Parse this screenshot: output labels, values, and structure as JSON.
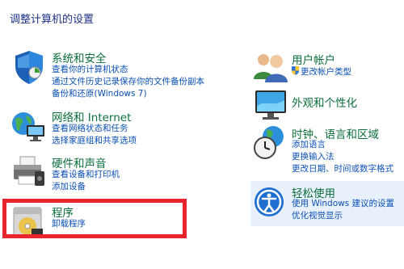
{
  "page_title": "调整计算机的设置",
  "left": {
    "system_security": {
      "title": "系统和安全",
      "links": [
        "查看你的计算机状态",
        "通过文件历史记录保存你的文件备份副本",
        "备份和还原(Windows 7)"
      ]
    },
    "network": {
      "title": "网络和 Internet",
      "links": [
        "查看网络状态和任务",
        "选择家庭组和共享选项"
      ]
    },
    "hardware": {
      "title": "硬件和声音",
      "links": [
        "查看设备和打印机",
        "添加设备"
      ]
    },
    "programs": {
      "title": "程序",
      "links": [
        "卸载程序"
      ]
    }
  },
  "right": {
    "user_accounts": {
      "title": "用户帐户",
      "links": [
        "更改帐户类型"
      ]
    },
    "appearance": {
      "title": "外观和个性化",
      "links": []
    },
    "clock_region": {
      "title": "时钟、语言和区域",
      "links": [
        "添加语言",
        "更换输入法",
        "更改日期、时间或数字格式"
      ]
    },
    "ease_access": {
      "title": "轻松使用",
      "links": [
        "使用 Windows 建议的设置",
        "优化视觉显示"
      ]
    }
  },
  "colors": {
    "title": "#1e3287",
    "category": "#0c6e3c",
    "link": "#0a4fb4",
    "highlight": "#e8252c",
    "hover_panel": "#e8f1fb"
  },
  "icons": [
    "shield-icon",
    "network-globe-icon",
    "printer-icon",
    "programs-disc-icon",
    "users-icon",
    "monitor-palette-icon",
    "clock-globe-icon",
    "ease-of-access-icon",
    "uac-shield-icon"
  ]
}
